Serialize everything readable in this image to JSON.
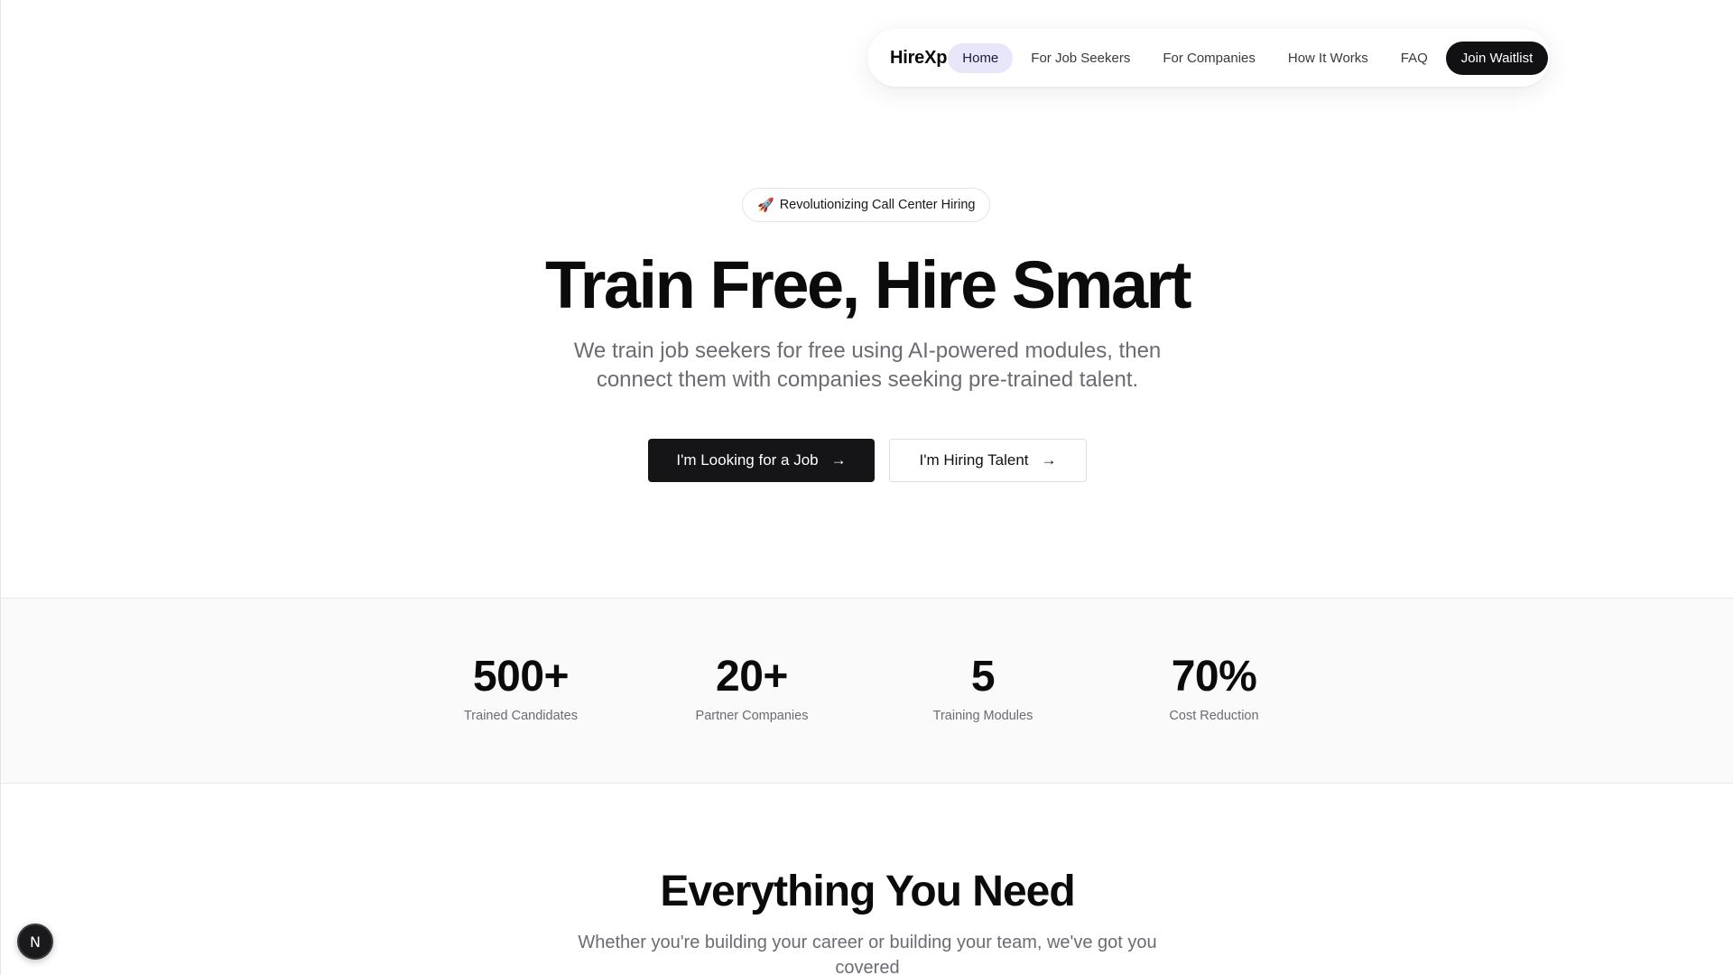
{
  "nav": {
    "brand": "HireXp",
    "items": [
      {
        "label": "Home",
        "active": true
      },
      {
        "label": "For Job Seekers"
      },
      {
        "label": "For Companies"
      },
      {
        "label": "How It Works"
      },
      {
        "label": "FAQ"
      }
    ],
    "cta": "Join Waitlist"
  },
  "hero": {
    "badge_icon": "🚀",
    "badge": "Revolutionizing Call Center Hiring",
    "title": "Train Free, Hire Smart",
    "subtitle": "We train job seekers for free using AI-powered modules, then connect them with companies seeking pre-trained talent.",
    "primary_button": "I'm Looking for a Job",
    "secondary_button": "I'm Hiring Talent",
    "arrow": "→"
  },
  "stats": [
    {
      "value": "500+",
      "label": "Trained Candidates"
    },
    {
      "value": "20+",
      "label": "Partner Companies"
    },
    {
      "value": "5",
      "label": "Training Modules"
    },
    {
      "value": "70%",
      "label": "Cost Reduction"
    }
  ],
  "section": {
    "title": "Everything You Need",
    "subtitle": "Whether you're building your career or building your team, we've got you covered"
  },
  "dev_badge": "N",
  "colors": {
    "primary": "#151517",
    "active_nav_bg": "#e8e6fb",
    "muted_text": "#6b6b73",
    "stats_bg": "#fafafa"
  }
}
